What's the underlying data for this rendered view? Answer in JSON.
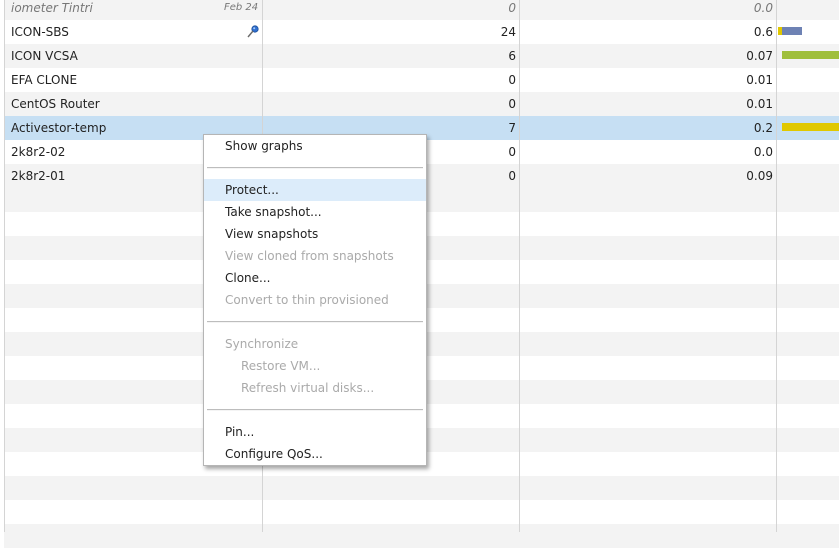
{
  "rows": [
    {
      "name": "iometer Tintri",
      "date": "Feb 24",
      "io": "0",
      "throughput": "0.0"
    },
    {
      "name": "ICON-SBS",
      "io": "24",
      "throughput": "0.6",
      "bar_color": "#6e82b4"
    },
    {
      "name": "ICON VCSA",
      "io": "6",
      "throughput": "0.07",
      "bar_color": "#9fbf3b"
    },
    {
      "name": "EFA CLONE",
      "io": "0",
      "throughput": "0.01"
    },
    {
      "name": "CentOS Router",
      "io": "0",
      "throughput": "0.01"
    },
    {
      "name": "Activestor-temp",
      "io": "7",
      "throughput": "0.2",
      "bar_color": "#e0c800"
    },
    {
      "name": "2k8r2-02",
      "io": "0",
      "throughput": "0.0"
    },
    {
      "name": "2k8r2-01",
      "io": "0",
      "throughput": "0.09"
    }
  ],
  "context_menu": {
    "show_graphs": "Show graphs",
    "protect": "Protect...",
    "take_snapshot": "Take snapshot...",
    "view_snapshots": "View snapshots",
    "view_cloned": "View cloned from snapshots",
    "clone": "Clone...",
    "convert_thin": "Convert to thin provisioned",
    "synchronize": "Synchronize",
    "restore_vm": "Restore VM...",
    "refresh_disks": "Refresh virtual disks...",
    "pin": "Pin...",
    "configure_qos": "Configure QoS..."
  },
  "icons": {
    "pin": "pin-icon"
  },
  "colors": {
    "selected_row": "#c6dff3",
    "menu_highlight": "#dcecfa"
  }
}
